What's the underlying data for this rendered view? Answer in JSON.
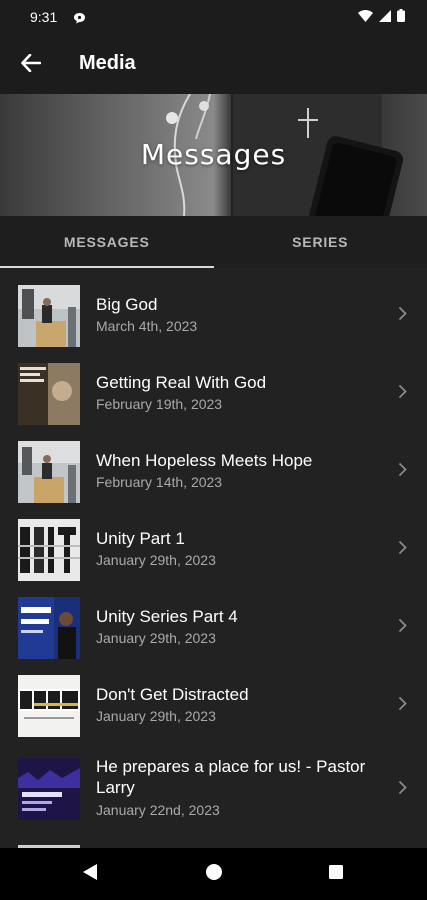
{
  "status_bar": {
    "time": "9:31"
  },
  "app_bar": {
    "title": "Media"
  },
  "banner": {
    "title": "Messages"
  },
  "tabs": [
    {
      "label": "MESSAGES",
      "active": true
    },
    {
      "label": "SERIES",
      "active": false
    }
  ],
  "messages": [
    {
      "title": "Big God",
      "date": "March 4th, 2023"
    },
    {
      "title": "Getting Real With God",
      "date": "February 19th, 2023"
    },
    {
      "title": "When Hopeless Meets Hope",
      "date": "February 14th, 2023"
    },
    {
      "title": "Unity Part 1",
      "date": "January 29th, 2023"
    },
    {
      "title": "Unity Series Part 4",
      "date": "January 29th, 2023"
    },
    {
      "title": "Don't Get Distracted",
      "date": "January 29th, 2023"
    },
    {
      "title": "He prepares a place for us! - Pastor Larry",
      "date": "January 22nd, 2023"
    }
  ],
  "colors": {
    "background": "#222222",
    "app_bar": "#1c1c1c",
    "text_primary": "#ffffff",
    "text_secondary": "#a9a9a9",
    "tab_indicator": "#d8d8d8"
  }
}
